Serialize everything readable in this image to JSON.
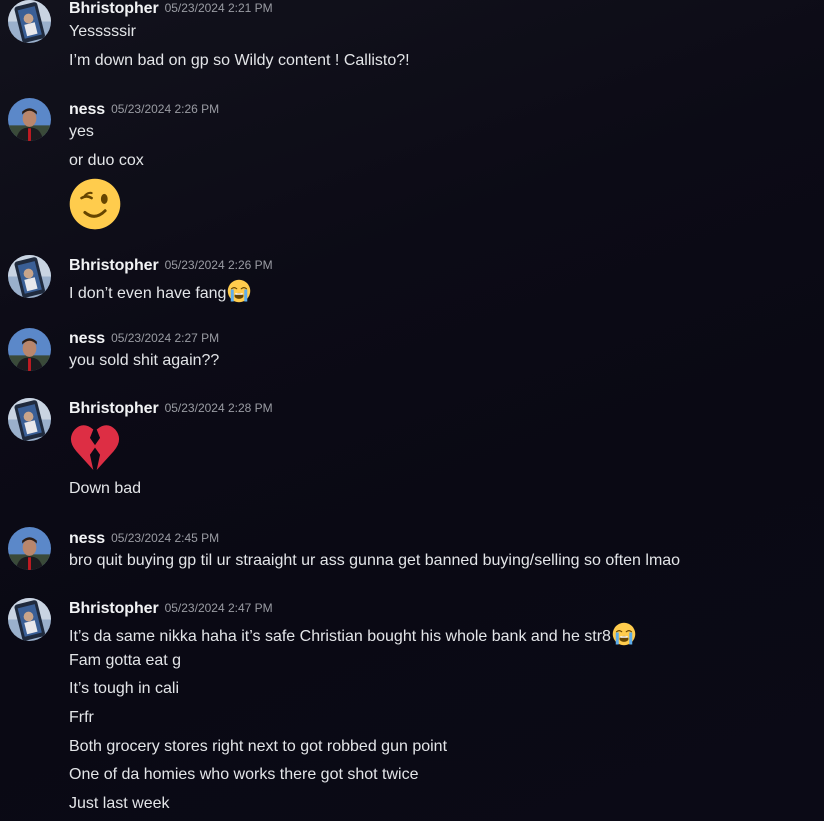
{
  "users": {
    "bhristopher": "Bhristopher",
    "ness": "ness"
  },
  "groups": [
    {
      "user": "Bhristopher",
      "time": "05/23/2024 2:21 PM",
      "lines": [
        "Yesssssir",
        "I’m down bad on gp so Wildy content ! Callisto?!"
      ]
    },
    {
      "user": "ness",
      "time": "05/23/2024 2:26 PM",
      "lines": [
        "yes",
        "or duo cox"
      ],
      "emoji": "winking-face-emoji"
    },
    {
      "user": "Bhristopher",
      "time": "05/23/2024 2:26 PM",
      "lines": [
        "I don’t even have fang"
      ],
      "inline_emoji": "loudly-crying-face-emoji"
    },
    {
      "user": "ness",
      "time": "05/23/2024 2:27 PM",
      "lines": [
        "you sold shit again??"
      ]
    },
    {
      "user": "Bhristopher",
      "time": "05/23/2024 2:28 PM",
      "emoji": "broken-heart-emoji",
      "lines": [
        "Down bad"
      ]
    },
    {
      "user": "ness",
      "time": "05/23/2024 2:45 PM",
      "lines": [
        "bro quit buying gp til ur straaight ur ass gunna get banned buying/selling so often lmao"
      ]
    },
    {
      "user": "Bhristopher",
      "time": "05/23/2024 2:47 PM",
      "lines": [
        "It’s da same nikka haha it’s safe Christian bought his whole bank and he str8",
        "Fam gotta eat g",
        "It’s tough in cali",
        "Frfr",
        "Both grocery stores right next to got robbed gun point",
        "One of da homies who works there got shot twice",
        "Just last week"
      ],
      "inline_emoji": "loudly-crying-face-emoji"
    }
  ],
  "colors": {
    "background": "#0c0b16",
    "username": "#f2f3f5",
    "timestamp": "#9a9ca3",
    "message_text": "#e3e5e8"
  }
}
